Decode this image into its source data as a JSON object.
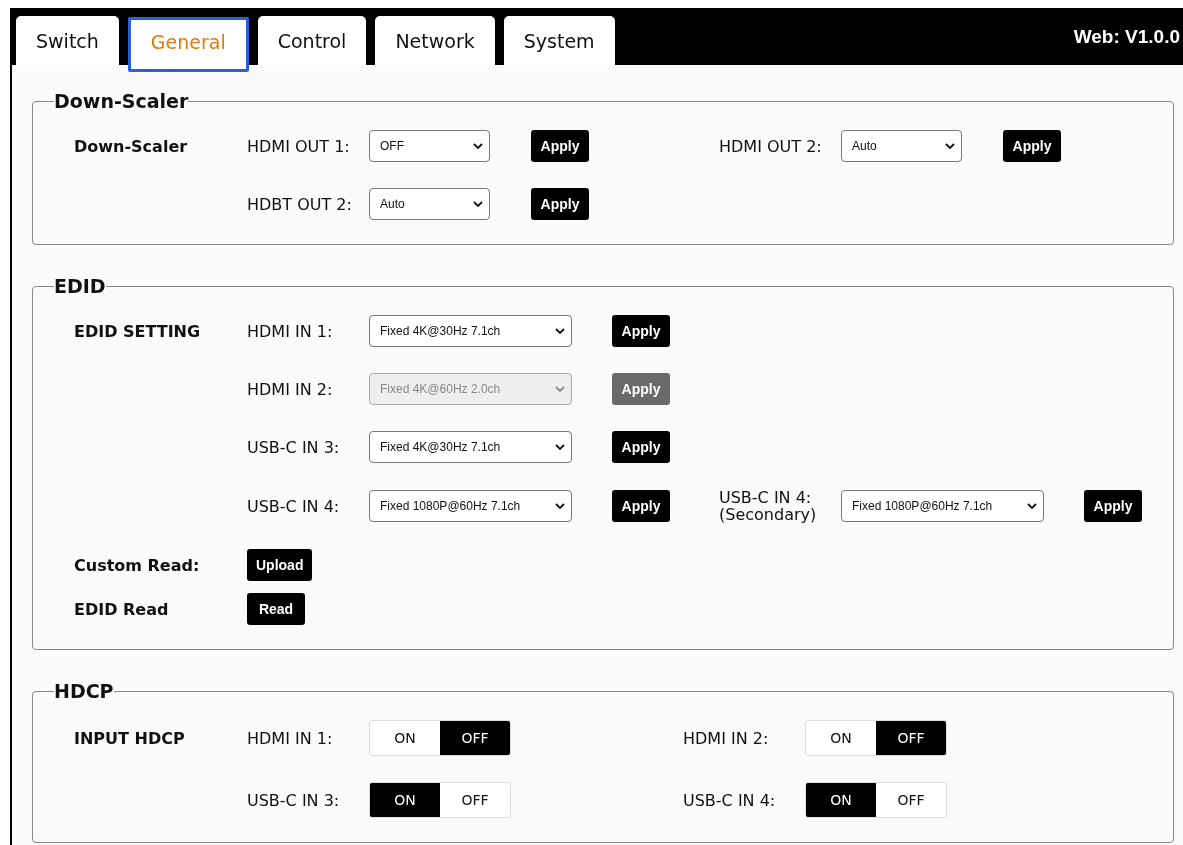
{
  "tabs": [
    {
      "label": "Switch",
      "selected": false
    },
    {
      "label": "General",
      "selected": true
    },
    {
      "label": "Control",
      "selected": false
    },
    {
      "label": "Network",
      "selected": false
    },
    {
      "label": "System",
      "selected": false
    }
  ],
  "version": "Web: V1.0.0",
  "sections": [
    {
      "title": "Down-Scaler",
      "rows": [
        {
          "label": "Down-Scaler",
          "items": [
            {
              "kind": "select",
              "label": "HDMI OUT 1:",
              "value": "OFF",
              "disabled": false,
              "button": "Apply"
            },
            {
              "kind": "select",
              "label": "HDMI OUT 2:",
              "value": "Auto",
              "disabled": false,
              "button": "Apply"
            }
          ]
        },
        {
          "items": [
            {
              "kind": "select",
              "label": "HDBT OUT 2:",
              "value": "Auto",
              "disabled": false,
              "button": "Apply"
            }
          ]
        }
      ]
    },
    {
      "title": "EDID",
      "rows": [
        {
          "label": "EDID SETTING",
          "items": [
            {
              "kind": "wide-select",
              "label": "HDMI IN 1:",
              "value": "Fixed 4K@30Hz 7.1ch",
              "disabled": false,
              "button": "Apply"
            }
          ]
        },
        {
          "items": [
            {
              "kind": "wide-select",
              "label": "HDMI IN 2:",
              "value": "Fixed 4K@60Hz 2.0ch",
              "disabled": true,
              "button": "Apply"
            }
          ]
        },
        {
          "items": [
            {
              "kind": "wide-select",
              "label": "USB-C IN 3:",
              "value": "Fixed 4K@30Hz 7.1ch",
              "disabled": false,
              "button": "Apply"
            }
          ]
        },
        {
          "items": [
            {
              "kind": "wide-select",
              "label": "USB-C IN 4:",
              "value": "Fixed 1080P@60Hz 7.1ch",
              "disabled": false,
              "button": "Apply"
            },
            {
              "kind": "wide-select",
              "label": "USB-C IN 4:\n(Secondary)",
              "value": "Fixed 1080P@60Hz 7.1ch",
              "disabled": false,
              "button": "Apply"
            }
          ]
        },
        {
          "label": "Custom Read:",
          "items": [
            {
              "kind": "button",
              "button": "Upload"
            }
          ]
        },
        {
          "label": "EDID Read",
          "items": [
            {
              "kind": "button",
              "button": "Read"
            }
          ]
        }
      ]
    },
    {
      "title": "HDCP",
      "rows": [
        {
          "label": "INPUT HDCP",
          "items": [
            {
              "kind": "toggle",
              "label": "HDMI IN 1:",
              "options": [
                {
                  "label": "ON",
                  "selected": false
                },
                {
                  "label": "OFF",
                  "selected": true
                }
              ]
            },
            {
              "kind": "toggle",
              "label": "HDMI IN 2:",
              "options": [
                {
                  "label": "ON",
                  "selected": false
                },
                {
                  "label": "OFF",
                  "selected": true
                }
              ]
            }
          ]
        },
        {
          "items": [
            {
              "kind": "toggle",
              "label": "USB-C IN 3:",
              "options": [
                {
                  "label": "ON",
                  "selected": true
                },
                {
                  "label": "OFF",
                  "selected": false
                }
              ]
            },
            {
              "kind": "toggle",
              "label": "USB-C IN 4:",
              "options": [
                {
                  "label": "ON",
                  "selected": true
                },
                {
                  "label": "OFF",
                  "selected": false
                }
              ]
            }
          ]
        }
      ]
    }
  ]
}
